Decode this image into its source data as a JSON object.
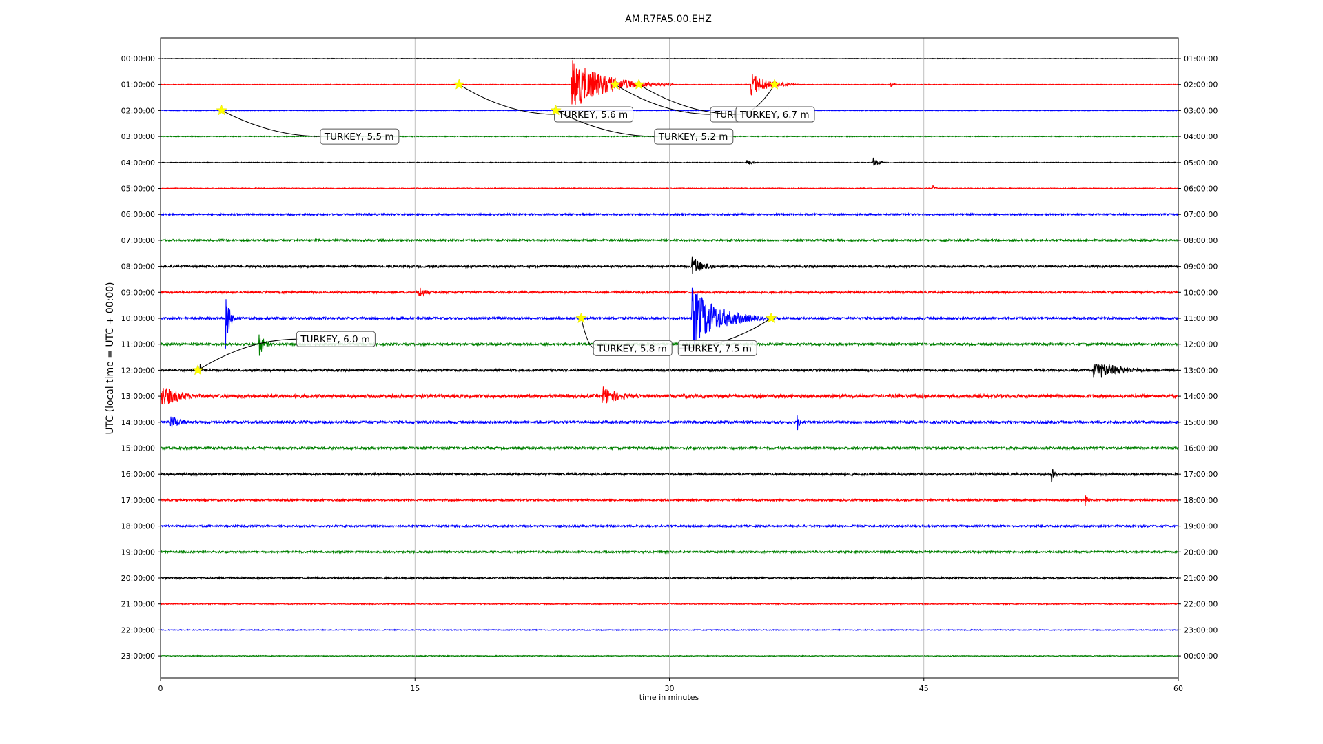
{
  "chart_data": {
    "type": "line",
    "title": "AM.R7FA5.00.EHZ",
    "xlabel": "time in minutes",
    "ylabel": "UTC (local time = UTC + 00:00)",
    "xlim": [
      0,
      60
    ],
    "x_ticks": [
      "0",
      "15",
      "30",
      "45",
      "60"
    ],
    "grid": "vertical lines at 15, 30, 45",
    "trace_colors": [
      "#000000",
      "#ff0000",
      "#0000ff",
      "#008000"
    ],
    "rows_left": [
      "00:00:00",
      "01:00:00",
      "02:00:00",
      "03:00:00",
      "04:00:00",
      "05:00:00",
      "06:00:00",
      "07:00:00",
      "08:00:00",
      "09:00:00",
      "10:00:00",
      "11:00:00",
      "12:00:00",
      "13:00:00",
      "14:00:00",
      "15:00:00",
      "16:00:00",
      "17:00:00",
      "18:00:00",
      "19:00:00",
      "20:00:00",
      "21:00:00",
      "22:00:00",
      "23:00:00"
    ],
    "rows_right": [
      "01:00:00",
      "02:00:00",
      "03:00:00",
      "04:00:00",
      "05:00:00",
      "06:00:00",
      "07:00:00",
      "08:00:00",
      "09:00:00",
      "10:00:00",
      "11:00:00",
      "12:00:00",
      "13:00:00",
      "14:00:00",
      "15:00:00",
      "16:00:00",
      "17:00:00",
      "18:00:00",
      "19:00:00",
      "20:00:00",
      "21:00:00",
      "22:00:00",
      "23:00:00",
      "00:00:00"
    ],
    "noise_level": [
      0.4,
      0.4,
      0.4,
      0.6,
      0.5,
      0.6,
      1.2,
      1.3,
      1.5,
      1.5,
      1.6,
      1.6,
      1.6,
      2.5,
      1.8,
      1.6,
      1.7,
      1.3,
      1.3,
      1.3,
      1.3,
      0.7,
      0.6,
      0.5
    ],
    "bursts": [
      {
        "row": 1,
        "minute": 24.2,
        "duration": 6,
        "amplitude": 38
      },
      {
        "row": 1,
        "minute": 34.8,
        "duration": 3,
        "amplitude": 18
      },
      {
        "row": 1,
        "minute": 43,
        "duration": 0.6,
        "amplitude": 6
      },
      {
        "row": 4,
        "minute": 34.5,
        "duration": 1,
        "amplitude": 5
      },
      {
        "row": 4,
        "minute": 42,
        "duration": 1,
        "amplitude": 7
      },
      {
        "row": 5,
        "minute": 45.5,
        "duration": 0.4,
        "amplitude": 8
      },
      {
        "row": 8,
        "minute": 31.3,
        "duration": 2,
        "amplitude": 16
      },
      {
        "row": 9,
        "minute": 15.2,
        "duration": 1.5,
        "amplitude": 10
      },
      {
        "row": 10,
        "minute": 3.8,
        "duration": 0.6,
        "amplitude": 60
      },
      {
        "row": 10,
        "minute": 31.3,
        "duration": 5,
        "amplitude": 45
      },
      {
        "row": 11,
        "minute": 5.8,
        "duration": 1,
        "amplitude": 18
      },
      {
        "row": 12,
        "minute": 55,
        "duration": 5,
        "amplitude": 14
      },
      {
        "row": 12,
        "minute": 2.3,
        "duration": 0.4,
        "amplitude": 12
      },
      {
        "row": 13,
        "minute": 0,
        "duration": 4,
        "amplitude": 16
      },
      {
        "row": 13,
        "minute": 26,
        "duration": 3,
        "amplitude": 16
      },
      {
        "row": 14,
        "minute": 0.5,
        "duration": 2,
        "amplitude": 12
      },
      {
        "row": 14,
        "minute": 37.5,
        "duration": 0.5,
        "amplitude": 16
      },
      {
        "row": 16,
        "minute": 52.5,
        "duration": 0.6,
        "amplitude": 14
      },
      {
        "row": 17,
        "minute": 54.5,
        "duration": 0.6,
        "amplitude": 10
      }
    ],
    "annotations": [
      {
        "label": "TURKEY, 5.5 m",
        "row": 2,
        "minute": 3.6,
        "label_minute": 9.5,
        "label_row": 3
      },
      {
        "label": "TURKEY, 5.6 m",
        "row": 1,
        "minute": 17.6,
        "label_minute": 23.3,
        "label_row": 2.15
      },
      {
        "label": "TURKEY, 5.2 m",
        "row": 2,
        "minute": 23.3,
        "label_minute": 29.2,
        "label_row": 3
      },
      {
        "label": "TURKEY, 6.7 m",
        "row": 1,
        "minute": 26.8,
        "label_minute": 32.5,
        "label_row": 2.15
      },
      {
        "label": "TURKEY, 6.7 m",
        "row": 1,
        "minute": 28.2,
        "label_minute": 34.0,
        "label_row": 2.15
      },
      {
        "label": "TURKEY, 6.7 m",
        "row": 1,
        "minute": 36.2,
        "label_minute": 34.0,
        "label_row": 2.15
      },
      {
        "label": "TURKEY, 6.0 m",
        "row": 12,
        "minute": 2.2,
        "label_minute": 8.1,
        "label_row": 10.8
      },
      {
        "label": "TURKEY, 5.8 m",
        "row": 10,
        "minute": 24.8,
        "label_minute": 25.6,
        "label_row": 11.15
      },
      {
        "label": "TURKEY, 7.5 m",
        "row": 10,
        "minute": 36.0,
        "label_minute": 30.6,
        "label_row": 11.15
      }
    ]
  }
}
